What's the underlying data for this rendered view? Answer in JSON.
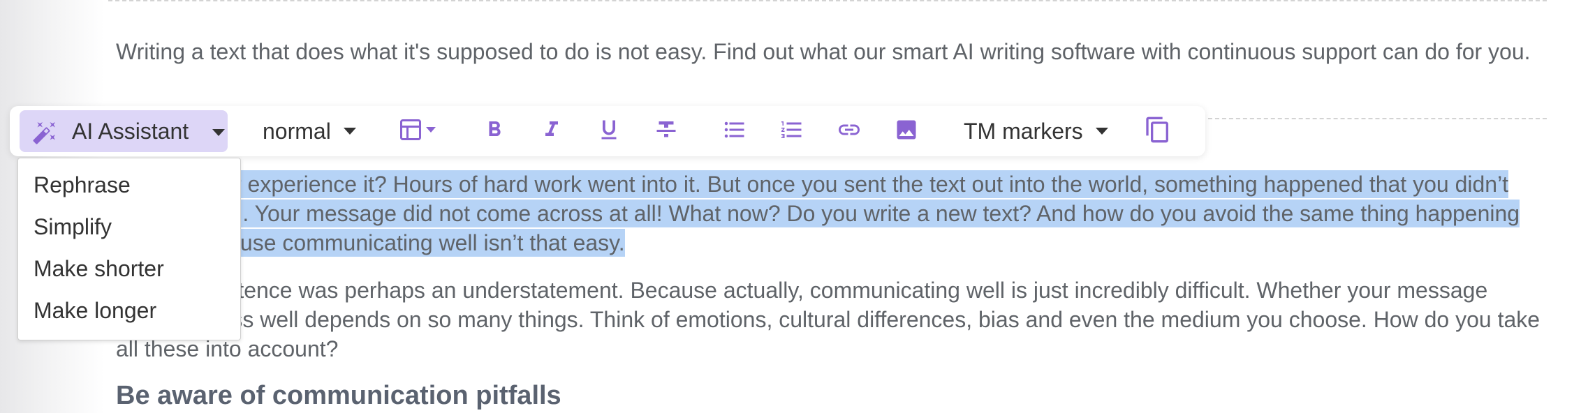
{
  "content": {
    "intro": "Writing a text that does what it's supposed to do is not easy. Find out what our smart AI writing software with continuous support can do for you.",
    "selected_paragraph": "Did you ever experience it? Hours of hard work went into it. But once you sent the text out into the world, something happened that you didn’t see coming... Your message did not come across at all! What now? Do you write a new text? And how do you avoid the same thing happening again? Because communicating well isn’t that easy.",
    "second_paragraph": "The last sentence was perhaps an understatement. Because actually, communicating well is just incredibly difficult. Whether your message comes across well depends on so many things. Think of emotions, cultural differences, bias and even the medium you choose. How do you take all these into account?",
    "heading": "Be aware of communication pitfalls"
  },
  "toolbar": {
    "ai_assistant_label": "AI Assistant",
    "text_style_value": "normal",
    "tm_markers_label": "TM markers",
    "icons": [
      "magic-wand-icon",
      "table-icon",
      "bold-icon",
      "italic-icon",
      "underline-icon",
      "strikethrough-icon",
      "bullet-list-icon",
      "numbered-list-icon",
      "link-icon",
      "image-icon",
      "copy-icon"
    ]
  },
  "ai_menu": {
    "items": [
      "Rephrase",
      "Simplify",
      "Make shorter",
      "Make longer"
    ]
  },
  "colors": {
    "accent": "#8a63d2",
    "ai_button_bg": "#ddd6f7",
    "selection": "#b6d3f6",
    "text": "#5f6368"
  }
}
